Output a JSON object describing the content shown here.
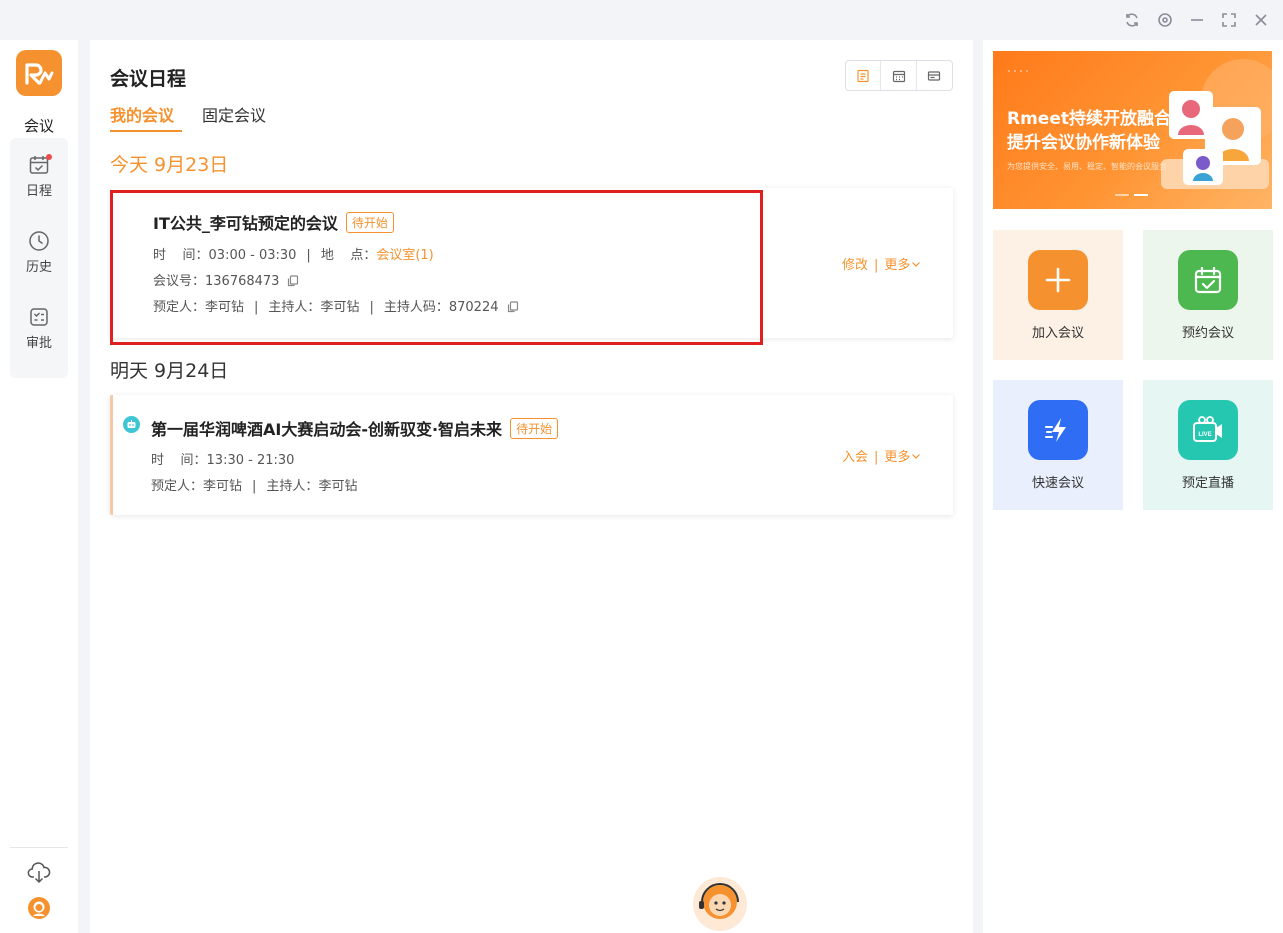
{
  "window_controls": {
    "icons": [
      "refresh-icon",
      "settings-icon",
      "minimize-icon",
      "maximize-icon",
      "close-icon"
    ]
  },
  "sidebar": {
    "top_label": "会议",
    "items": [
      {
        "label": "日程",
        "icon": "calendar-icon",
        "has_dot": true
      },
      {
        "label": "历史",
        "icon": "clock-icon"
      },
      {
        "label": "审批",
        "icon": "approval-icon"
      }
    ]
  },
  "main": {
    "title": "会议日程",
    "tabs": [
      {
        "label": "我的会议",
        "active": true
      },
      {
        "label": "固定会议",
        "active": false
      }
    ],
    "days": [
      {
        "header": "今天  9月23日",
        "meetings": [
          {
            "title": "IT公共_李可钻预定的会议",
            "status": "待开始",
            "time_label": "时    间：",
            "time": "03:00 - 03:30",
            "location_label": "地    点：",
            "location": "会议室(1)",
            "meeting_id_label": "会议号：",
            "meeting_id": "136768473",
            "booker_label": "预定人：",
            "booker": "李可钻",
            "host_label": "主持人：",
            "host": "李可钻",
            "host_code_label": "主持人码：",
            "host_code": "870224",
            "action_primary": "修改",
            "action_more": "更多"
          }
        ]
      },
      {
        "header": "明天  9月24日",
        "meetings": [
          {
            "title": "第一届华润啤酒AI大赛启动会-创新驭变·智启未来",
            "status": "待开始",
            "time_label": "时    间：",
            "time": "13:30 - 21:30",
            "booker_label": "预定人：",
            "booker": "李可钻",
            "host_label": "主持人：",
            "host": "李可钻",
            "action_primary": "入会",
            "action_more": "更多"
          }
        ]
      }
    ]
  },
  "right_panel": {
    "banner": {
      "title_line1": "Rmeet持续开放融合",
      "title_line2": "提升会议协作新体验",
      "subtitle": "为您提供安全、易用、稳定、智能的会议服务"
    },
    "actions": [
      {
        "label": "加入会议",
        "icon": "plus-icon",
        "color": "#f5922f"
      },
      {
        "label": "预约会议",
        "icon": "calendar-check-icon",
        "color": "#4cb84f"
      },
      {
        "label": "快速会议",
        "icon": "lightning-icon",
        "color": "#2f6df5"
      },
      {
        "label": "预定直播",
        "icon": "live-camera-icon",
        "color": "#26c7b1"
      }
    ]
  },
  "colors": {
    "accent": "#f5922f",
    "highlight": "#e02020"
  }
}
